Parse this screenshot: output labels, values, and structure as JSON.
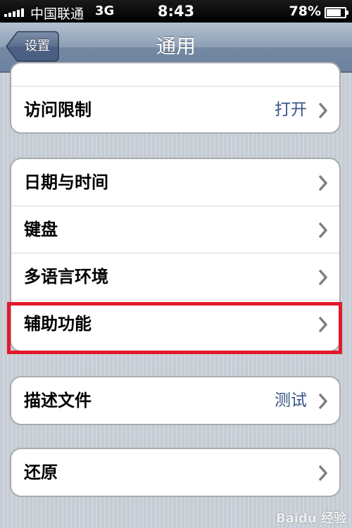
{
  "status_bar": {
    "carrier": "中国联通",
    "network": "3G",
    "time": "8:43",
    "battery_percent_label": "78%",
    "battery_level": 0.78,
    "signal_bars": 5
  },
  "nav_bar": {
    "back_label": "设置",
    "title": "通用"
  },
  "groups": [
    {
      "rows": [
        {
          "label": "访问限制",
          "value": "打开"
        }
      ]
    },
    {
      "rows": [
        {
          "label": "日期与时间",
          "value": ""
        },
        {
          "label": "键盘",
          "value": ""
        },
        {
          "label": "多语言环境",
          "value": ""
        },
        {
          "label": "辅助功能",
          "value": ""
        }
      ]
    },
    {
      "rows": [
        {
          "label": "描述文件",
          "value": "测试"
        }
      ]
    },
    {
      "rows": [
        {
          "label": "还原",
          "value": ""
        }
      ]
    }
  ],
  "highlighted_row": "辅助功能",
  "watermark": "Baidu 经验",
  "colors": {
    "value_text": "#385487",
    "highlight_border": "#e2192c",
    "nav_bar_top": "#b4c0d0",
    "nav_bar_bottom": "#6d82a0"
  },
  "icons": {
    "row_disclosure": "chevron-right-icon",
    "back": "back-arrow-button"
  }
}
